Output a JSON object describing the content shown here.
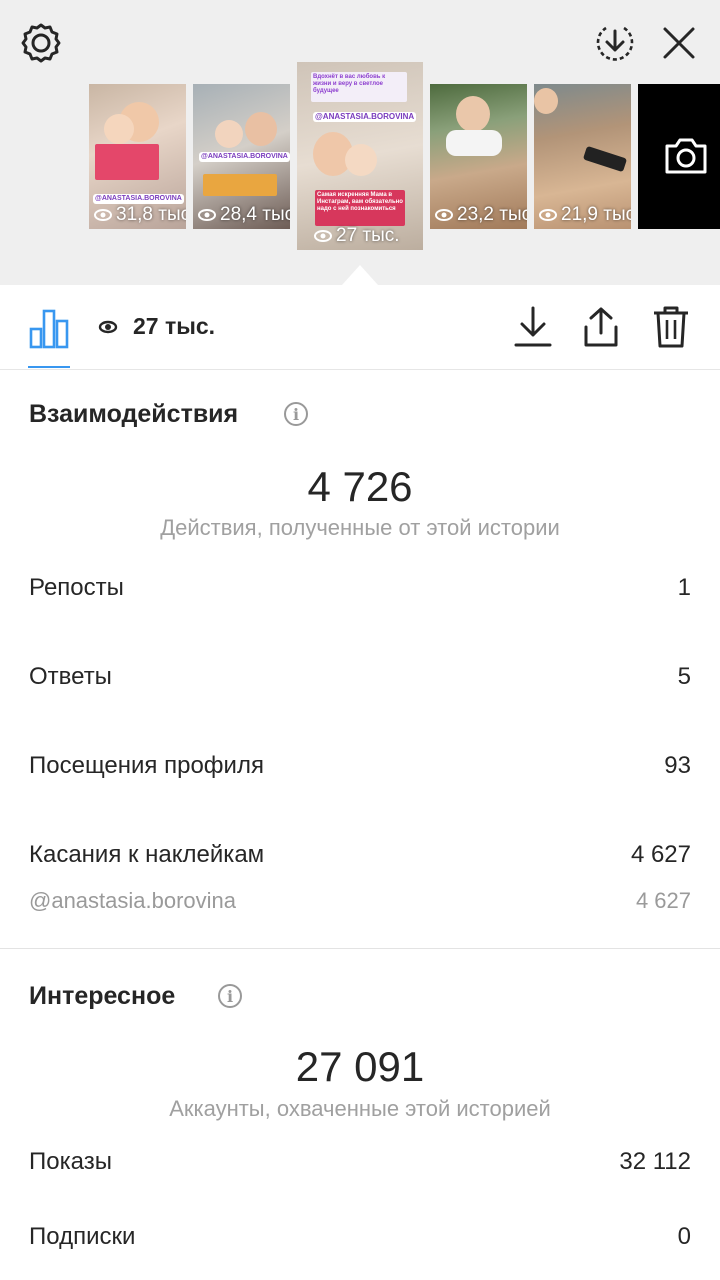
{
  "header": {
    "icons": [
      "gear-icon",
      "download-circle-icon",
      "close-icon",
      "camera-icon"
    ]
  },
  "stories": [
    {
      "views": "31,8 тыс.",
      "selected": false,
      "sticker": "@ANASTASIA.BOROVINA"
    },
    {
      "views": "28,4 тыс.",
      "selected": false,
      "sticker": "@ANASTASIA.BOROVINA"
    },
    {
      "views": "27 тыс.",
      "selected": true,
      "sticker": "@ANASTASIA.BOROVINA",
      "top_text": "Вдохнёт в вас любовь к жизни и веру в светлое будущее",
      "bottom_text": "Самая искренняя Мама в Инстаграм, вам обязательно надо с ней познакомиться"
    },
    {
      "views": "23,2 тыс.",
      "selected": false
    },
    {
      "views": "21,9 тыс.",
      "selected": false
    }
  ],
  "toolbar": {
    "views": "27 тыс.",
    "icons": [
      "bar-chart-icon",
      "eye-icon",
      "download-icon",
      "share-icon",
      "trash-icon"
    ]
  },
  "interactions": {
    "title": "Взаимодействия",
    "total": "4 726",
    "caption": "Действия, полученные от этой истории",
    "rows": [
      {
        "label": "Репосты",
        "value": "1"
      },
      {
        "label": "Ответы",
        "value": "5"
      },
      {
        "label": "Посещения профиля",
        "value": "93"
      },
      {
        "label": "Касания к наклейкам",
        "value": "4 627"
      }
    ],
    "sub_row": {
      "label": "@anastasia.borovina",
      "value": "4 627"
    }
  },
  "discovery": {
    "title": "Интересное",
    "total": "27 091",
    "caption": "Аккаунты, охваченные этой историей",
    "rows": [
      {
        "label": "Показы",
        "value": "32 112"
      },
      {
        "label": "Подписки",
        "value": "0"
      }
    ]
  },
  "colors": {
    "accent": "#3897f0",
    "muted": "#9a9a9a",
    "top_bg": "#efefef"
  }
}
